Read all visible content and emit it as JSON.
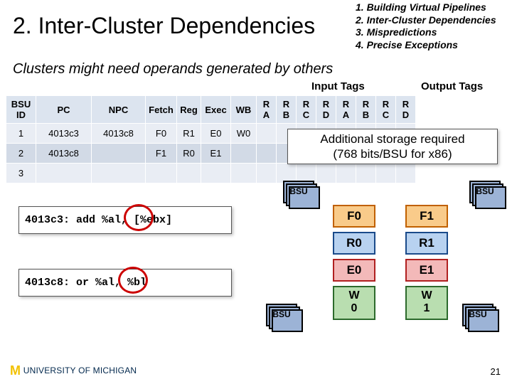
{
  "title": "2. Inter-Cluster Dependencies",
  "outline": {
    "i1": "1. Building Virtual Pipelines",
    "i2": "2. Inter-Cluster Dependencies",
    "i3": "3. Mispredictions",
    "i4": "4. Precise Exceptions"
  },
  "subtitle": "Clusters might need operands generated by others",
  "headers": {
    "input": "Input Tags",
    "output": "Output Tags"
  },
  "table": {
    "cols": {
      "bsu": "BSU ID",
      "pc": "PC",
      "npc": "NPC",
      "fetch": "Fetch",
      "reg": "Reg",
      "exec": "Exec",
      "wb": "WB",
      "ra": "R A",
      "rb": "R B",
      "rc": "R C",
      "rd": "R D",
      "wa": "R A",
      "wb2": "R B",
      "wc": "R C",
      "wd": "R D"
    },
    "rows": [
      {
        "id": "1",
        "pc": "4013c3",
        "npc": "4013c8",
        "fetch": "F0",
        "reg": "R1",
        "exec": "E0",
        "wb": "W0"
      },
      {
        "id": "2",
        "pc": "4013c8",
        "npc": "",
        "fetch": "F1",
        "reg": "R0",
        "exec": "E1",
        "wb": ""
      },
      {
        "id": "3",
        "pc": "",
        "npc": "",
        "fetch": "",
        "reg": "",
        "exec": "",
        "wb": ""
      }
    ]
  },
  "callout": {
    "l1": "Additional storage required",
    "l2": "(768 bits/BSU for x86)"
  },
  "instr": {
    "a": "4013c3: add %al, [%ebx]",
    "b": "4013c8: or %al, %bl"
  },
  "pipe": {
    "bsu": "BSU",
    "F0": "F0",
    "F1": "F1",
    "R0": "R0",
    "R1": "R1",
    "E0": "E0",
    "E1": "E1",
    "W0a": "W",
    "W0b": "0",
    "W1a": "W",
    "W1b": "1"
  },
  "logo": {
    "m": "M",
    "text": "UNIVERSITY OF MICHIGAN"
  },
  "page": "21"
}
